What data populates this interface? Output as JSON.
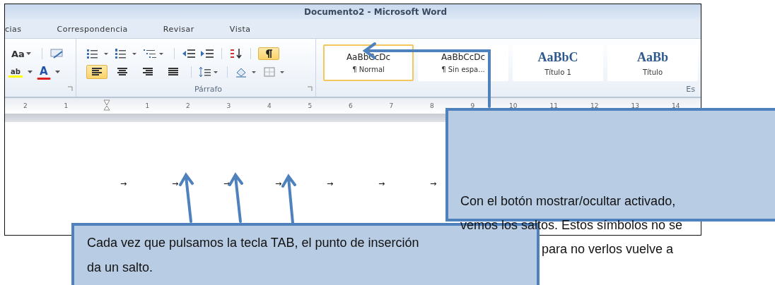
{
  "window": {
    "title": "Documento2 - Microsoft Word"
  },
  "ribbon_tabs": [
    {
      "label": "cias"
    },
    {
      "label": "Correspondencia"
    },
    {
      "label": "Revisar"
    },
    {
      "label": "Vista"
    }
  ],
  "ribbon": {
    "font_group": {
      "change_case": "Aa",
      "highlight": "ab",
      "font_color": "A"
    },
    "paragraph_group": {
      "label": "Párrafo",
      "show_hide": {
        "selected": true
      },
      "alignment": [
        {
          "kind": "left",
          "selected": true
        },
        {
          "kind": "center",
          "selected": false
        },
        {
          "kind": "right",
          "selected": false
        },
        {
          "kind": "justify",
          "selected": false
        }
      ]
    },
    "styles_group": {
      "label": "Es",
      "items": [
        {
          "preview": "AaBbCcDc",
          "name": "¶ Normal",
          "kind": "body",
          "selected": true
        },
        {
          "preview": "AaBbCcDc",
          "name": "¶ Sin espa...",
          "kind": "body",
          "selected": false
        },
        {
          "preview": "AaBbC",
          "name": "Título 1",
          "kind": "heading",
          "selected": false
        },
        {
          "preview": "AaBb",
          "name": "Título",
          "kind": "heading",
          "selected": false
        }
      ]
    }
  },
  "ruler": {
    "left_numbers": [
      "2",
      "1"
    ],
    "numbers": [
      "1",
      "2",
      "3",
      "4",
      "5",
      "6",
      "7",
      "8",
      "9",
      "10",
      "11",
      "12",
      "13",
      "14"
    ]
  },
  "document": {
    "tab_marks": [
      "→",
      "→",
      "→",
      "→",
      "→",
      "→",
      "→"
    ]
  },
  "callouts": [
    {
      "kind": "bottom",
      "lines": [
        "Cada vez que pulsamos la tecla TAB, el punto de inserción",
        "da un salto."
      ]
    },
    {
      "kind": "right",
      "lines": [
        {
          "text": "Con el botón mostrar/ocultar activado,",
          "kind": "inside"
        },
        {
          "text": "vemos los saltos. Estos símbolos no se",
          "kind": "overflow"
        },
        {
          "text": "para no verlos vuelve a",
          "kind": "covered"
        }
      ]
    }
  ]
}
